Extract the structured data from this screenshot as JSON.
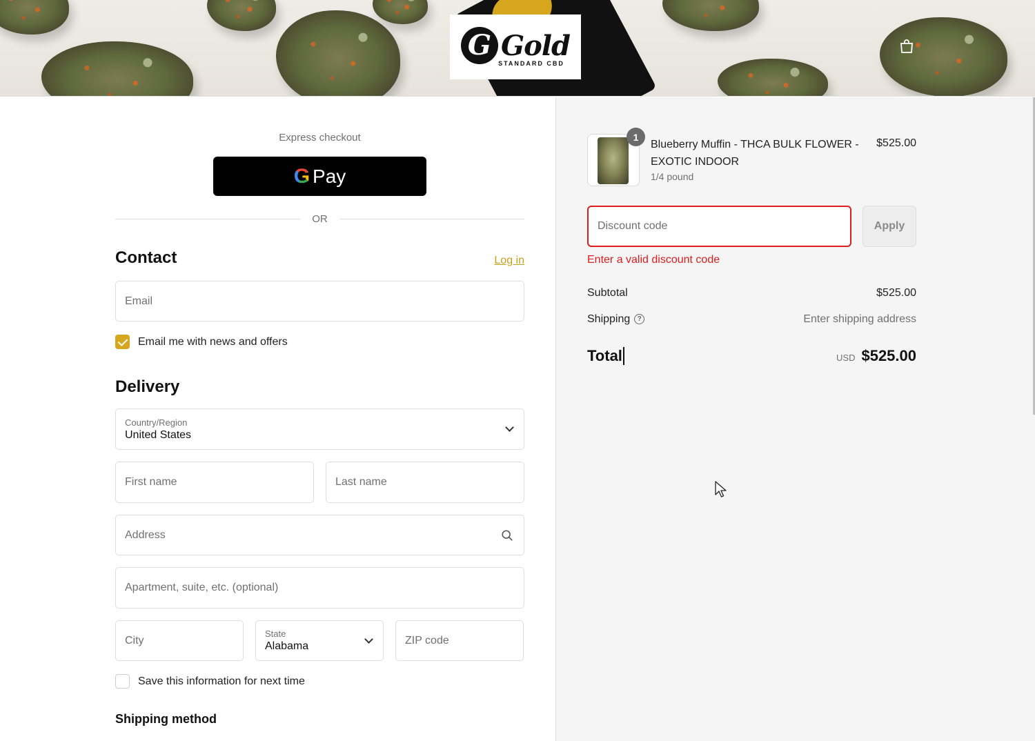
{
  "header": {
    "logo_word": "Gold",
    "logo_sub": "STANDARD CBD",
    "logo_letter": "G",
    "cart_icon": "shopping-bag-icon"
  },
  "express": {
    "label": "Express checkout",
    "gpay_g": "G",
    "gpay_text": "Pay",
    "or": "OR"
  },
  "contact": {
    "heading": "Contact",
    "login": "Log in",
    "email_placeholder": "Email",
    "news_label": "Email me with news and offers",
    "news_checked": true
  },
  "delivery": {
    "heading": "Delivery",
    "country_label": "Country/Region",
    "country_value": "United States",
    "first_name": "First name",
    "last_name": "Last name",
    "address": "Address",
    "apartment": "Apartment, suite, etc. (optional)",
    "city": "City",
    "state_label": "State",
    "state_value": "Alabama",
    "zip": "ZIP code",
    "save_label": "Save this information for next time",
    "save_checked": false
  },
  "shipping_method": {
    "heading": "Shipping method"
  },
  "summary": {
    "item": {
      "quantity": "1",
      "title": "Blueberry Muffin - THCA BULK FLOWER - EXOTIC INDOOR",
      "variant": "1/4 pound",
      "price": "$525.00"
    },
    "discount_placeholder": "Discount code",
    "apply": "Apply",
    "error": "Enter a valid discount code",
    "subtotal_label": "Subtotal",
    "subtotal_value": "$525.00",
    "shipping_label": "Shipping",
    "shipping_value": "Enter shipping address",
    "total_label": "Total",
    "currency": "USD",
    "total_value": "$525.00"
  },
  "colors": {
    "accent": "#d6a71c",
    "error": "#dd1d1d"
  }
}
